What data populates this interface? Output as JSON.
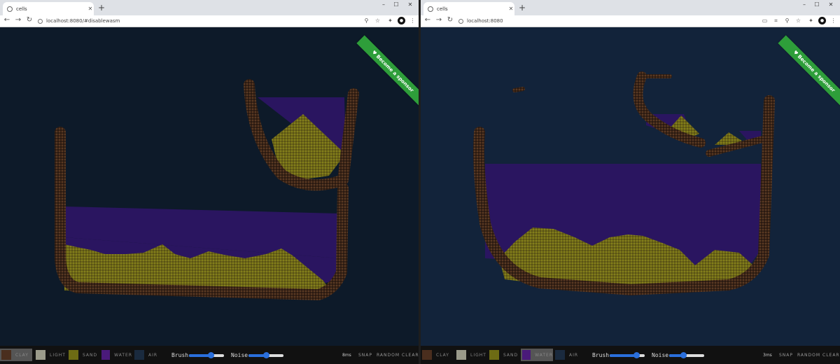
{
  "left": {
    "tab_title": "cells",
    "url": "localhost:8080/#disablewasm",
    "ribbon": "♥ Become a sponsor",
    "materials": [
      {
        "label": "CLAY",
        "color": "#4a2e1e"
      },
      {
        "label": "LIGHT",
        "color": "#9a9a8a"
      },
      {
        "label": "SAND",
        "color": "#6d6b14"
      },
      {
        "label": "WATER",
        "color": "#4a1a7a"
      },
      {
        "label": "AIR",
        "color": "#1a2a3e"
      }
    ],
    "selected_material": "CLAY",
    "brush_label": "Brush",
    "noise_label": "Noise",
    "brush_value": 0.62,
    "noise_value": 0.5,
    "frame_time": "8ms",
    "snap_label": "SNAP",
    "random_label": "RANDOM",
    "clear_label": "CLEAR"
  },
  "right": {
    "tab_title": "cells",
    "url": "localhost:8080",
    "ribbon": "♥ Become a sponsor",
    "materials": [
      {
        "label": "CLAY",
        "color": "#4a2e1e"
      },
      {
        "label": "LIGHT",
        "color": "#9a9a8a"
      },
      {
        "label": "SAND",
        "color": "#6d6b14"
      },
      {
        "label": "WATER",
        "color": "#4a1a7a"
      },
      {
        "label": "AIR",
        "color": "#1a2a3e"
      }
    ],
    "selected_material": "WATER",
    "brush_label": "Brush",
    "noise_label": "Noise",
    "brush_value": 0.75,
    "noise_value": 0.4,
    "frame_time": "3ms",
    "snap_label": "SNAP",
    "random_label": "RANDOM",
    "clear_label": "CLEAR"
  },
  "colors": {
    "background": "#0d1a29",
    "clay": "#3a2418",
    "sand": "#6b6a14",
    "water": "#2a1560",
    "ribbon": "#2e9e3a",
    "slider": "#2a6fdc"
  }
}
